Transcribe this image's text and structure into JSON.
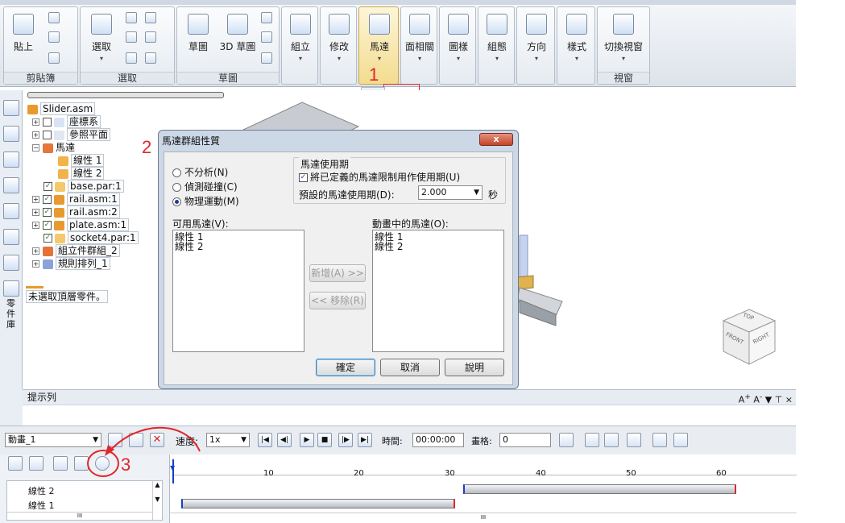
{
  "ribbon": {
    "groups": [
      {
        "label": "剪貼簿",
        "buttons": [
          "貼上"
        ]
      },
      {
        "label": "選取",
        "buttons": [
          "選取"
        ]
      },
      {
        "label": "草圖",
        "buttons": [
          "草圖",
          "3D 草圖"
        ]
      },
      {
        "label": "",
        "buttons": [
          "組立"
        ]
      },
      {
        "label": "",
        "buttons": [
          "修改"
        ]
      },
      {
        "label": "",
        "buttons": [
          "馬達"
        ]
      },
      {
        "label": "",
        "buttons": [
          "面相關"
        ]
      },
      {
        "label": "",
        "buttons": [
          "圖樣"
        ]
      },
      {
        "label": "",
        "buttons": [
          "組態"
        ]
      },
      {
        "label": "",
        "buttons": [
          "方向"
        ]
      },
      {
        "label": "",
        "buttons": [
          "樣式"
        ]
      },
      {
        "label": "視窗",
        "buttons": [
          "切換視窗"
        ]
      }
    ]
  },
  "annotations": {
    "step1": "1",
    "step2": "2",
    "step3": "3"
  },
  "tree": {
    "root": "Slider.asm",
    "items": [
      "座標系",
      "參照平面",
      "馬達",
      "線性 1",
      "線性 2",
      "base.par:1",
      "rail.asm:1",
      "rail.asm:2",
      "plate.asm:1",
      "socket4.par:1",
      "組立件群組_2",
      "規則排列_1"
    ],
    "footer": "未選取頂層零件。"
  },
  "left_toolbar": {
    "vertical_label": "零件庫"
  },
  "dialog": {
    "title": "馬達群組性質",
    "close": "x",
    "radio_options": [
      "不分析(N)",
      "偵測碰撞(C)",
      "物理運動(M)"
    ],
    "selected_radio": 2,
    "duration_group_title": "馬達使用期",
    "limit_checkbox_label": "將已定義的馬達限制用作使用期(U)",
    "limit_checked": true,
    "default_duration_label": "預設的馬達使用期(D):",
    "default_duration_value": "2.000",
    "duration_unit": "秒",
    "available_label": "可用馬達(V):",
    "available_motors": [
      "線性 1",
      "線性 2"
    ],
    "animated_label": "動畫中的馬達(O):",
    "animated_motors": [
      "線性 1",
      "線性 2"
    ],
    "add_button": "新增(A) >>",
    "remove_button": "<< 移除(R)",
    "ok_button": "確定",
    "cancel_button": "取消",
    "help_button": "說明"
  },
  "status_bar": {
    "title": "提示列"
  },
  "view_cube": {
    "top": "TOP",
    "front": "FRONT",
    "right": "RIGHT"
  },
  "animation": {
    "name": "動畫_1",
    "speed_label": "速度:",
    "speed_value": "1x",
    "time_label": "時間:",
    "time_value": "00:00:00",
    "frame_label": "畫格:",
    "frame_value": "0"
  },
  "timeline": {
    "ticks": [
      "10",
      "20",
      "30",
      "40",
      "50",
      "60"
    ],
    "rows": [
      "線性 2",
      "線性 1"
    ],
    "scroll_label": "III"
  }
}
